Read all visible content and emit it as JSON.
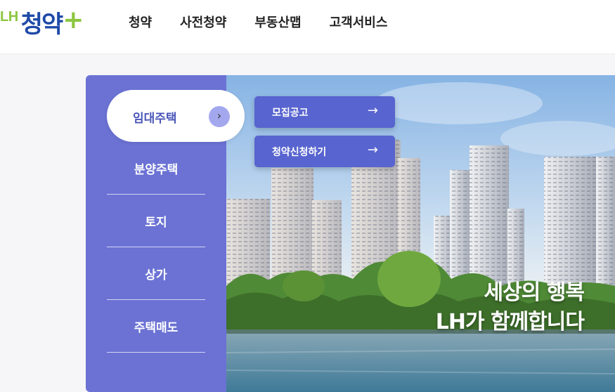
{
  "header": {
    "logo": {
      "prefix": "LH",
      "main": "청약",
      "suffix": "+"
    },
    "nav": [
      "청약",
      "사전청약",
      "부동산맵",
      "고객서비스"
    ]
  },
  "sidebar": {
    "active": {
      "label": "임대주택",
      "icon": "chevron-right-icon"
    },
    "items": [
      "분양주택",
      "토지",
      "상가",
      "주택매도"
    ]
  },
  "submenu": [
    {
      "label": "모집공고",
      "icon": "arrow-right-icon"
    },
    {
      "label": "청약신청하기",
      "icon": "arrow-right-icon"
    }
  ],
  "hero": {
    "line1": "세상의 행복",
    "line2": "LH가 함께합니다"
  },
  "colors": {
    "brand_blue": "#1f4aa8",
    "brand_green": "#8cc63f",
    "sidebar": "#6b72d4",
    "button": "#5864cf"
  }
}
